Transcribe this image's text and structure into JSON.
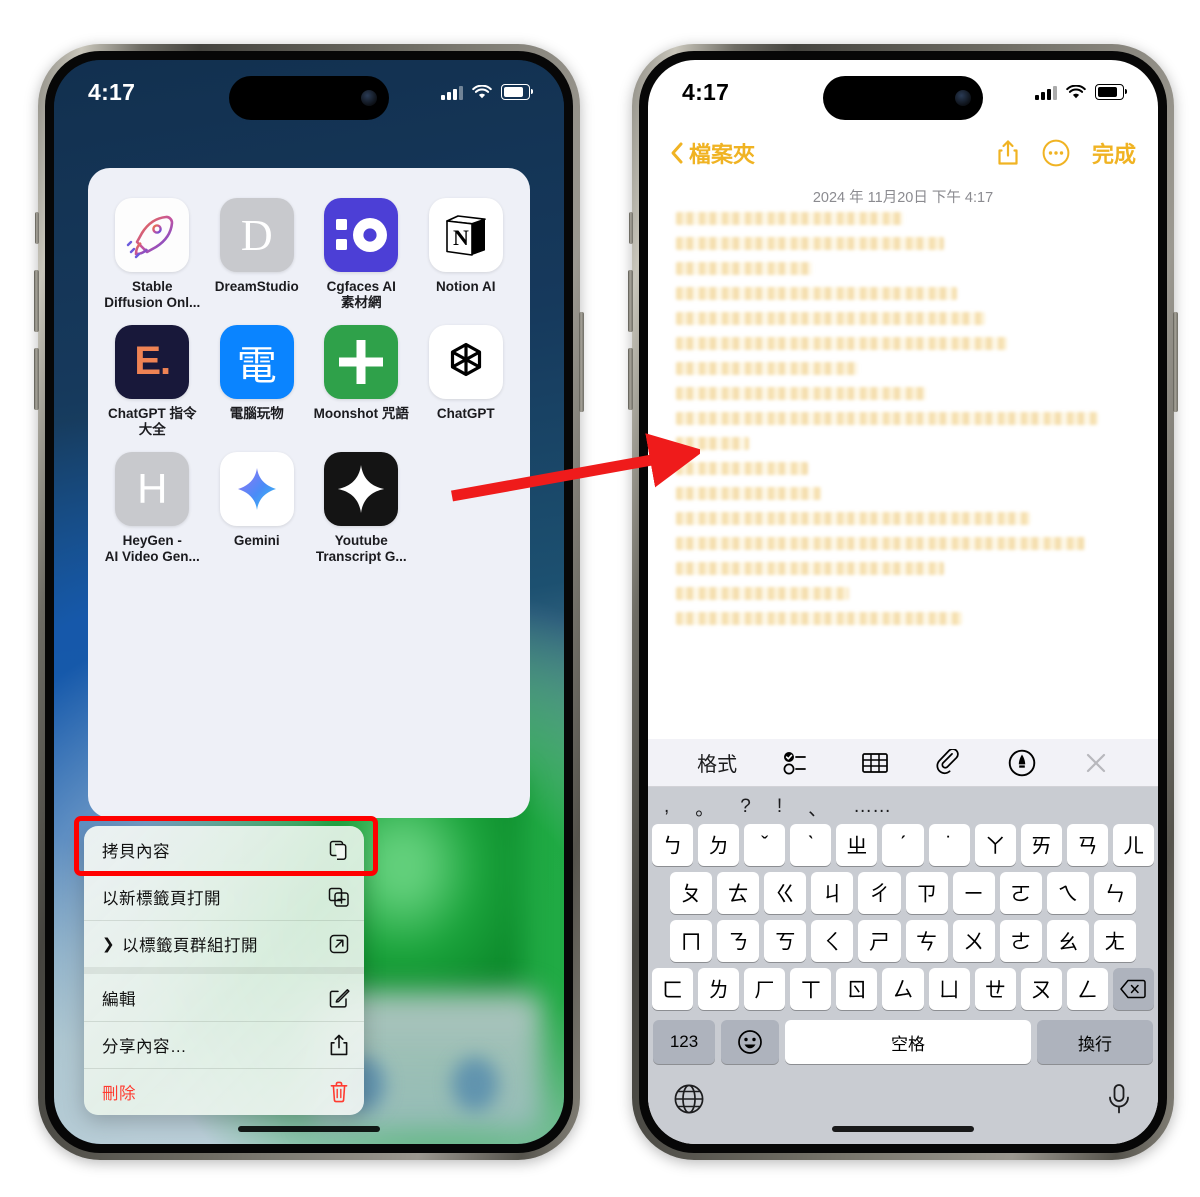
{
  "left_phone": {
    "status_bar": {
      "time": "4:17",
      "signal_icon": "cellular-bars-icon",
      "wifi_icon": "wifi-icon",
      "battery_icon": "battery-icon"
    },
    "app_grid": [
      {
        "label": "Stable\nDiffusion Onl...",
        "label_line1": "Stable",
        "label_line2": "Diffusion Onl...",
        "icon": "rocket-icon",
        "bg": "#fdfdfd"
      },
      {
        "label": "DreamStudio",
        "label_line1": "DreamStudio",
        "label_line2": "",
        "icon": "letter-d-icon",
        "bg": "#c8c9cd"
      },
      {
        "label": "Cgfaces AI\n素材網",
        "label_line1": "Cgfaces AI",
        "label_line2": "素材網",
        "icon": "cgfaces-icon",
        "bg": "#4c3fd6"
      },
      {
        "label": "Notion AI",
        "label_line1": "Notion AI",
        "label_line2": "",
        "icon": "notion-n-icon",
        "bg": "#ffffff"
      },
      {
        "label": "ChatGPT 指令\n大全",
        "label_line1": "ChatGPT 指令",
        "label_line2": "大全",
        "icon": "letter-e-icon",
        "bg": "#18183a"
      },
      {
        "label": "電腦玩物",
        "label_line1": "電腦玩物",
        "label_line2": "",
        "icon": "dian-char-icon",
        "bg": "#0a84ff"
      },
      {
        "label": "Moonshot 咒語",
        "label_line1": "Moonshot 咒語",
        "label_line2": "",
        "icon": "plus-cross-icon",
        "bg": "#2fa14a"
      },
      {
        "label": "ChatGPT",
        "label_line1": "ChatGPT",
        "label_line2": "",
        "icon": "openai-logo-icon",
        "bg": "#ffffff"
      },
      {
        "label": "HeyGen -\nAI Video Gen...",
        "label_line1": "HeyGen -",
        "label_line2": "AI Video Gen...",
        "icon": "letter-h-icon",
        "bg": "#c8c9cd"
      },
      {
        "label": "Gemini",
        "label_line1": "Gemini",
        "label_line2": "",
        "icon": "gemini-spark-icon",
        "bg": "#ffffff"
      },
      {
        "label": "Youtube\nTranscript G...",
        "label_line1": "Youtube",
        "label_line2": "Transcript G...",
        "icon": "four-point-star-icon",
        "bg": "#141414"
      }
    ],
    "context_menu": {
      "items": [
        {
          "label": "拷貝內容",
          "icon": "copy-icon",
          "danger": false,
          "has_chevron": false,
          "highlighted": true
        },
        {
          "label": "以新標籤頁打開",
          "icon": "new-tab-icon",
          "danger": false,
          "has_chevron": false,
          "highlighted": false
        },
        {
          "label": "以標籤頁群組打開",
          "icon": "open-external-icon",
          "danger": false,
          "has_chevron": true,
          "highlighted": false
        },
        {
          "label": "編輯",
          "icon": "edit-pencil-icon",
          "danger": false,
          "has_chevron": false,
          "highlighted": false
        },
        {
          "label": "分享內容…",
          "icon": "share-icon",
          "danger": false,
          "has_chevron": false,
          "highlighted": false
        },
        {
          "label": "刪除",
          "icon": "trash-icon",
          "danger": true,
          "has_chevron": false,
          "highlighted": false
        }
      ],
      "highlight_color": "#ff0000",
      "danger_color": "#ff3b30"
    }
  },
  "right_phone": {
    "status_bar": {
      "time": "4:17",
      "signal_icon": "cellular-bars-icon",
      "wifi_icon": "wifi-icon",
      "battery_icon": "battery-icon"
    },
    "nav_bar": {
      "back_label": "檔案夾",
      "back_icon": "chevron-left-icon",
      "share_icon": "share-icon",
      "more_icon": "ellipsis-circle-icon",
      "done_label": "完成",
      "accent_color": "#f0b323"
    },
    "note": {
      "date": "2024 年 11月20日 下午 4:17",
      "redacted_line_widths": [
        50,
        59,
        30,
        62,
        68,
        73,
        40,
        55,
        93,
        16,
        29,
        32,
        78,
        90,
        59,
        38,
        63
      ],
      "redaction_color": "#f0d288"
    },
    "keyboard_toolbar": {
      "format_label": "格式",
      "icons": [
        "checklist-icon",
        "table-icon",
        "attachment-icon",
        "markup-pen-icon",
        "close-icon"
      ]
    },
    "keyboard": {
      "punctuation_row": [
        ",",
        "。",
        "?",
        "!",
        "、",
        "……"
      ],
      "row1": [
        "ㄅ",
        "ㄉ",
        "ˇ",
        "ˋ",
        "ㄓ",
        "ˊ",
        "˙",
        "ㄚ",
        "ㄞ",
        "ㄢ",
        "ㄦ"
      ],
      "row2": [
        "ㄆ",
        "ㄊ",
        "ㄍ",
        "ㄐ",
        "ㄔ",
        "ㄗ",
        "ㄧ",
        "ㄛ",
        "ㄟ",
        "ㄣ"
      ],
      "row3": [
        "ㄇ",
        "ㄋ",
        "ㄎ",
        "ㄑ",
        "ㄕ",
        "ㄘ",
        "ㄨ",
        "ㄜ",
        "ㄠ",
        "ㄤ"
      ],
      "row4": [
        "ㄈ",
        "ㄌ",
        "ㄏ",
        "ㄒ",
        "ㄖ",
        "ㄙ",
        "ㄩ",
        "ㄝ",
        "ㄡ",
        "ㄥ"
      ],
      "backspace_icon": "backspace-icon",
      "numbers_key": "123",
      "emoji_key_icon": "emoji-icon",
      "space_key": "空格",
      "return_key": "換行",
      "globe_icon": "globe-icon",
      "mic_icon": "microphone-icon"
    }
  },
  "annotation": {
    "arrow_icon": "red-arrow-icon",
    "arrow_color": "#ef1b1b"
  }
}
